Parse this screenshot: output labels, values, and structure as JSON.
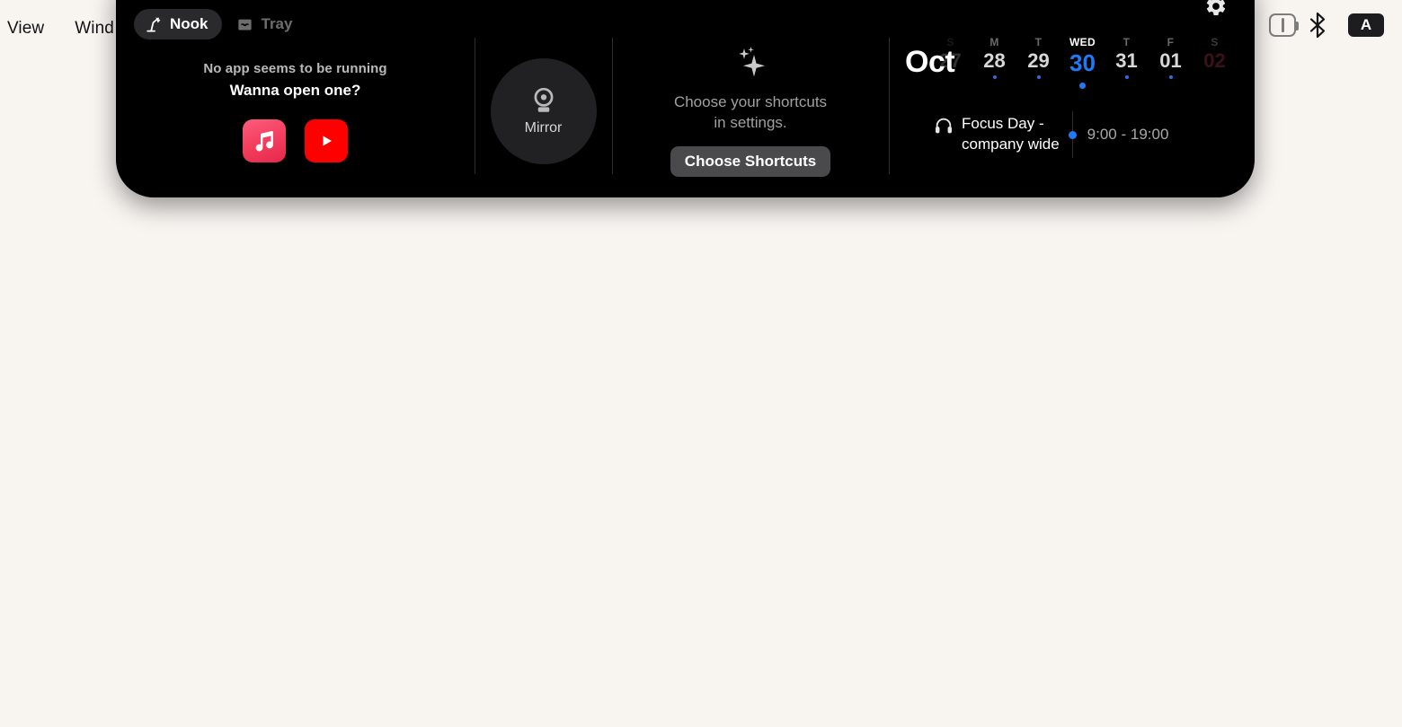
{
  "menubar": {
    "items": [
      {
        "label": "View"
      },
      {
        "label": "Wind"
      }
    ],
    "status": {
      "gear_icon": "gear-icon",
      "battery_icon": "battery-warning-icon",
      "bluetooth_icon": "bluetooth-icon",
      "input_source_label": "A"
    }
  },
  "panel": {
    "tabs": [
      {
        "label": "Nook",
        "icon": "desk-lamp-icon",
        "active": true
      },
      {
        "label": "Tray",
        "icon": "tray-icon",
        "active": false
      }
    ],
    "player": {
      "line1": "No app seems to be running",
      "line2": "Wanna open one?",
      "apps": [
        {
          "name": "apple-music-icon",
          "label": "Music"
        },
        {
          "name": "youtube-icon",
          "label": "YouTube"
        }
      ]
    },
    "mirror": {
      "icon": "webcam-icon",
      "label": "Mirror"
    },
    "shortcuts": {
      "icon": "sparkles-icon",
      "text_line1": "Choose your shortcuts",
      "text_line2": "in settings.",
      "button_label": "Choose Shortcuts"
    },
    "calendar": {
      "month": "Oct",
      "days": [
        {
          "dow": "S",
          "num": "27",
          "dot": false,
          "today": false,
          "state": "faded-left"
        },
        {
          "dow": "M",
          "num": "28",
          "dot": true,
          "today": false,
          "state": ""
        },
        {
          "dow": "T",
          "num": "29",
          "dot": true,
          "today": false,
          "state": ""
        },
        {
          "dow": "WED",
          "num": "30",
          "dot": true,
          "today": true,
          "state": ""
        },
        {
          "dow": "T",
          "num": "31",
          "dot": true,
          "today": false,
          "state": ""
        },
        {
          "dow": "F",
          "num": "01",
          "dot": true,
          "today": false,
          "state": ""
        },
        {
          "dow": "S",
          "num": "02",
          "dot": false,
          "today": false,
          "state": "faded-right"
        }
      ],
      "event": {
        "icon": "headphones-icon",
        "title_line1": "Focus Day -",
        "title_line2": "company wide",
        "time": "9:00 - 19:00",
        "dot_color": "#1e7bf7"
      }
    }
  },
  "colors": {
    "desktop_bg": "#f8f5f1",
    "panel_bg": "#000000",
    "accent_blue": "#1e7bf7",
    "tab_active_bg": "#2a2a2c",
    "button_bg": "#4a4a4c"
  }
}
